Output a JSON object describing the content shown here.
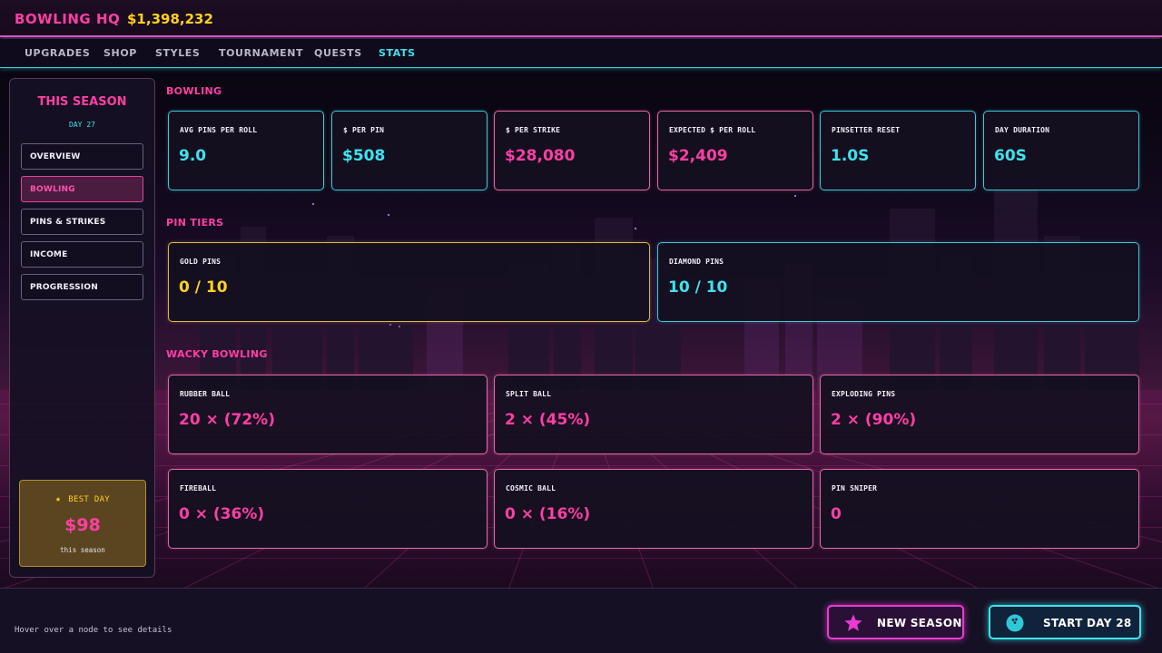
{
  "header": {
    "title": "BOWLING HQ",
    "money": "$1,398,232"
  },
  "nav": {
    "tabs": [
      {
        "label": "UPGRADES"
      },
      {
        "label": "SHOP"
      },
      {
        "label": "STYLES"
      },
      {
        "label": "TOURNAMENT"
      },
      {
        "label": "QUESTS"
      },
      {
        "label": "STATS"
      }
    ],
    "active": "STATS"
  },
  "sidebar": {
    "title": "THIS SEASON",
    "day": "DAY 27",
    "items": [
      {
        "label": "OVERVIEW"
      },
      {
        "label": "BOWLING"
      },
      {
        "label": "PINS & STRIKES"
      },
      {
        "label": "INCOME"
      },
      {
        "label": "PROGRESSION"
      }
    ],
    "active": "BOWLING",
    "best_day": {
      "label": "BEST DAY",
      "value": "$98",
      "sub": "this season"
    }
  },
  "sections": {
    "bowling": {
      "title": "BOWLING",
      "cards": [
        {
          "label": "AVG PINS PER ROLL",
          "value": "9.0"
        },
        {
          "label": "$ PER PIN",
          "value": "$508"
        },
        {
          "label": "$ PER STRIKE",
          "value": "$28,080"
        },
        {
          "label": "EXPECTED $ PER ROLL",
          "value": "$2,409"
        },
        {
          "label": "PINSETTER RESET",
          "value": "1.0S"
        },
        {
          "label": "DAY DURATION",
          "value": "60S"
        }
      ]
    },
    "pin_tiers": {
      "title": "PIN TIERS",
      "cards": [
        {
          "label": "GOLD PINS",
          "value": "0 / 10"
        },
        {
          "label": "DIAMOND PINS",
          "value": "10 / 10"
        }
      ]
    },
    "wacky": {
      "title": "WACKY BOWLING",
      "cards": [
        {
          "label": "RUBBER BALL",
          "value": "20 × (72%)"
        },
        {
          "label": "SPLIT BALL",
          "value": "2 × (45%)"
        },
        {
          "label": "EXPLODING PINS",
          "value": "2 × (90%)"
        },
        {
          "label": "FIREBALL",
          "value": "0 × (36%)"
        },
        {
          "label": "COSMIC BALL",
          "value": "0 × (16%)"
        },
        {
          "label": "PIN SNIPER",
          "value": "0"
        }
      ]
    }
  },
  "footer": {
    "hint": "Hover over a node to see details",
    "new_season": "NEW SEASON",
    "start_day": "START DAY 28"
  },
  "icons": {
    "star": "star-icon",
    "new_season": "star-icon",
    "start_day": "bowling-ball-icon"
  },
  "colors": {
    "accent_pink": "#ff3fa4",
    "accent_cyan": "#3ee3ee",
    "accent_gold": "#ffd21f"
  }
}
